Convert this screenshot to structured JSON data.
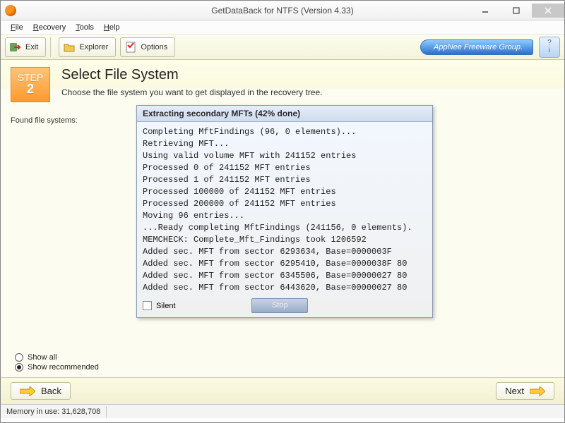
{
  "window": {
    "title": "GetDataBack for NTFS (Version 4.33)"
  },
  "menu": {
    "file": "File",
    "recovery": "Recovery",
    "tools": "Tools",
    "help": "Help"
  },
  "toolbar": {
    "exit": "Exit",
    "explorer": "Explorer",
    "options": "Options",
    "branding": "AppNee Freeware Group."
  },
  "step": {
    "label": "STEP",
    "number": "2",
    "heading": "Select File System",
    "subtitle": "Choose the file system you want to get displayed in the recovery tree."
  },
  "found_label": "Found file systems:",
  "dialog": {
    "title": "Extracting secondary MFTs (42% done)",
    "lines": [
      "Completing MftFindings (96, 0 elements)...",
      "Retrieving MFT...",
      "Using valid volume MFT with 241152 entries",
      "Processed 0 of 241152 MFT entries",
      "Processed 1 of 241152 MFT entries",
      "Processed 100000 of 241152 MFT entries",
      "Processed 200000 of 241152 MFT entries",
      "Moving 96 entries...",
      "...Ready completing MftFindings (241156, 0 elements).",
      "MEMCHECK: Complete_Mft_Findings took 1206592",
      "Added sec. MFT from sector 6293634, Base=0000003F",
      "Added sec. MFT from sector 6295410, Base=0000038F 80",
      "Added sec. MFT from sector 6345506, Base=00000027 80",
      "Added sec. MFT from sector 6443620, Base=00000027 80"
    ],
    "silent_label": "Silent",
    "stop_label": "Stop"
  },
  "filter": {
    "show_all": "Show all",
    "show_recommended": "Show recommended",
    "selected": "recommended"
  },
  "nav": {
    "back": "Back",
    "next": "Next"
  },
  "status": {
    "memory": "Memory in use: 31,628,708"
  }
}
